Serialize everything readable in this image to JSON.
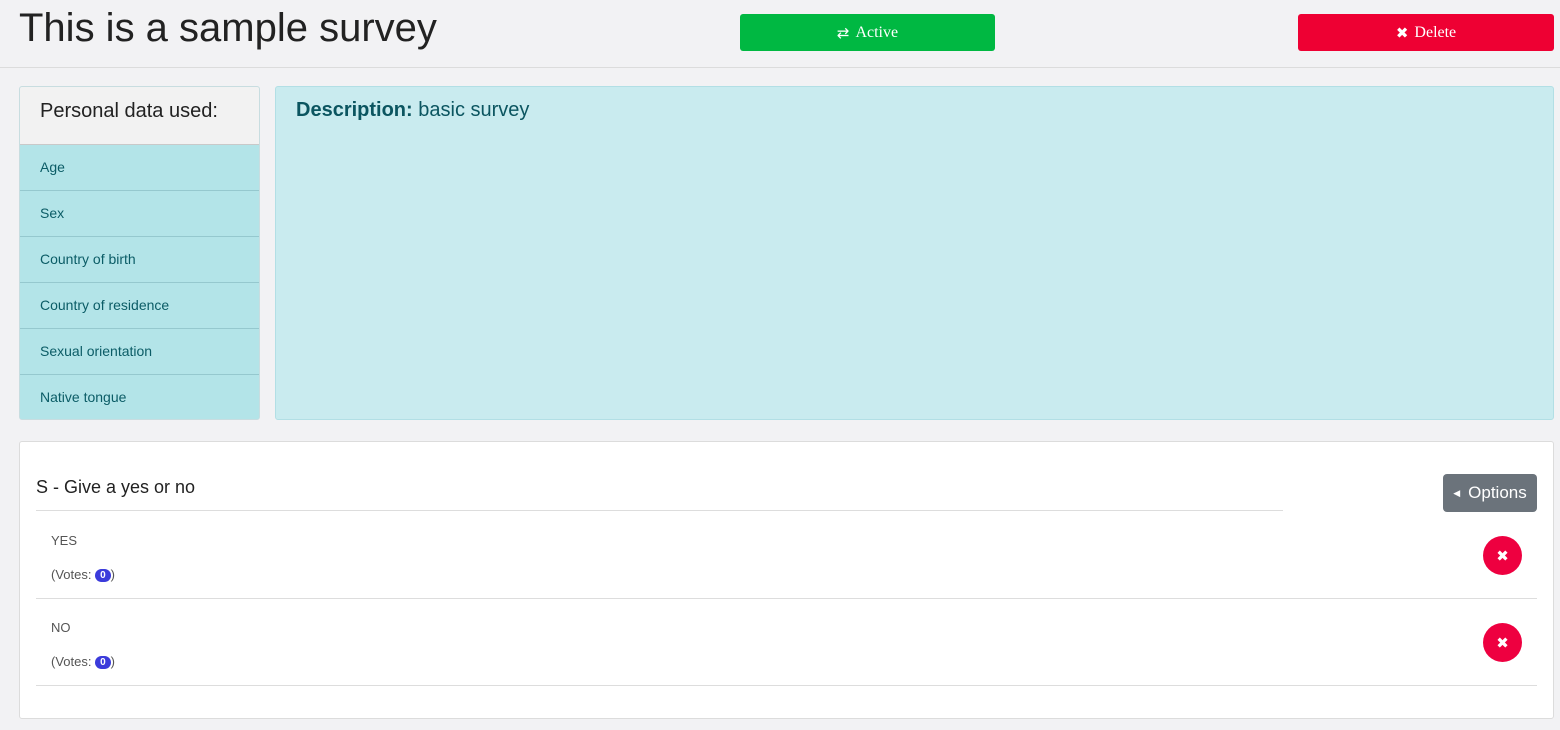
{
  "header": {
    "title": "This is a sample survey",
    "active_button": {
      "icon": "exchange-icon",
      "glyph": "⇄",
      "label": "Active",
      "color": "#00b842"
    },
    "delete_button": {
      "icon": "times-icon",
      "glyph": "✖",
      "label": "Delete",
      "color": "#ee0033"
    }
  },
  "personal_data": {
    "heading": "Personal data used:",
    "items": [
      {
        "label": "Age"
      },
      {
        "label": "Sex"
      },
      {
        "label": "Country of birth"
      },
      {
        "label": "Country of residence"
      },
      {
        "label": "Sexual orientation"
      },
      {
        "label": "Native tongue"
      }
    ]
  },
  "description": {
    "label": "Description:",
    "text": "basic survey"
  },
  "question": {
    "title": "S - Give a yes or no",
    "options_button": {
      "label": "Options",
      "caret": "◀"
    },
    "answers": [
      {
        "label": "YES",
        "votes_prefix": "(Votes:",
        "votes": "0",
        "votes_suffix": ")",
        "delete_glyph": "✖"
      },
      {
        "label": "NO",
        "votes_prefix": "(Votes:",
        "votes": "0",
        "votes_suffix": ")",
        "delete_glyph": "✖"
      }
    ]
  }
}
